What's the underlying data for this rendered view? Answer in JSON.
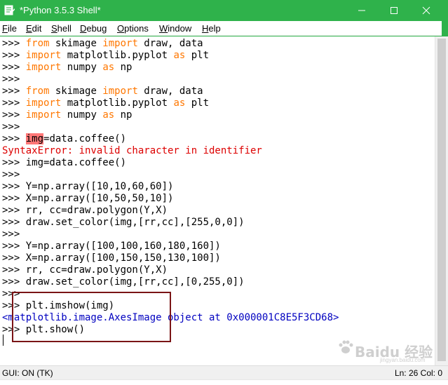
{
  "window": {
    "title": "*Python 3.5.3 Shell*",
    "frame_color": "#2fb24b",
    "controls": {
      "minimize_icon": "minimize-icon",
      "maximize_icon": "maximize-icon",
      "close_icon": "close-icon"
    }
  },
  "menu": {
    "items": [
      {
        "label": "File",
        "mnemonic": "F",
        "rest": "ile"
      },
      {
        "label": "Edit",
        "mnemonic": "E",
        "rest": "dit"
      },
      {
        "label": "Shell",
        "mnemonic": "S",
        "rest": "hell"
      },
      {
        "label": "Debug",
        "mnemonic": "D",
        "rest": "ebug"
      },
      {
        "label": "Options",
        "mnemonic": "O",
        "rest": "ptions"
      },
      {
        "label": "Window",
        "mnemonic": "W",
        "rest": "indow"
      },
      {
        "label": "Help",
        "mnemonic": "H",
        "rest": "elp"
      }
    ]
  },
  "shell": {
    "prompt": ">>> ",
    "lines": [
      {
        "prompt": ">>> ",
        "a": "",
        "k1": "from",
        "b": " skimage ",
        "k2": "import",
        "c": " draw, data"
      },
      {
        "prompt": ">>> ",
        "a": "",
        "k1": "import",
        "b": " matplotlib.pyplot ",
        "k2": "as",
        "c": " plt"
      },
      {
        "prompt": ">>> ",
        "a": "",
        "k1": "import",
        "b": " numpy ",
        "k2": "as",
        "c": " np"
      },
      {
        "prompt": ">>> ",
        "a": "",
        "k1": "",
        "b": "",
        "k2": "",
        "c": ""
      },
      {
        "prompt": ">>> ",
        "a": "",
        "k1": "from",
        "b": " skimage ",
        "k2": "import",
        "c": " draw, data"
      },
      {
        "prompt": ">>> ",
        "a": "",
        "k1": "import",
        "b": " matplotlib.pyplot ",
        "k2": "as",
        "c": " plt"
      },
      {
        "prompt": ">>> ",
        "a": "",
        "k1": "import",
        "b": " numpy ",
        "k2": "as",
        "c": " np"
      },
      {
        "prompt": ">>> ",
        "a": "",
        "k1": "",
        "b": "",
        "k2": "",
        "c": ""
      }
    ],
    "error_input": {
      "prompt": ">>> ",
      "highlight": "img",
      "rest": "=data.coffee()"
    },
    "error_message": "SyntaxError: invalid character in identifier",
    "lines2": [
      ">>> img=data.coffee()",
      ">>> ",
      ">>> Y=np.array([10,10,60,60])",
      ">>> X=np.array([10,50,50,10])",
      ">>> rr, cc=draw.polygon(Y,X)",
      ">>> draw.set_color(img,[rr,cc],[255,0,0])",
      ">>> ",
      ">>> Y=np.array([100,100,160,180,160])",
      ">>> X=np.array([100,150,150,130,100])",
      ">>> rr, cc=draw.polygon(Y,X)",
      ">>> draw.set_color(img,[rr,cc],[0,255,0])",
      ">>> ",
      ">>> plt.imshow(img)"
    ],
    "output_line": "<matplotlib.image.AxesImage object at 0x000001C8E5F3CD68>",
    "last_line": ">>> plt.show()"
  },
  "status": {
    "left": "GUI: ON (TK)",
    "right": "Ln: 26  Col: 0"
  },
  "watermark": {
    "text": "Baidu 经验",
    "sub": "jingyan.baidu.com"
  },
  "colors": {
    "keyword": "#ff7700",
    "error": "#dd0000",
    "output": "#0000c0",
    "error_highlight": "#ff7777",
    "annotation_box": "#7a1416"
  }
}
